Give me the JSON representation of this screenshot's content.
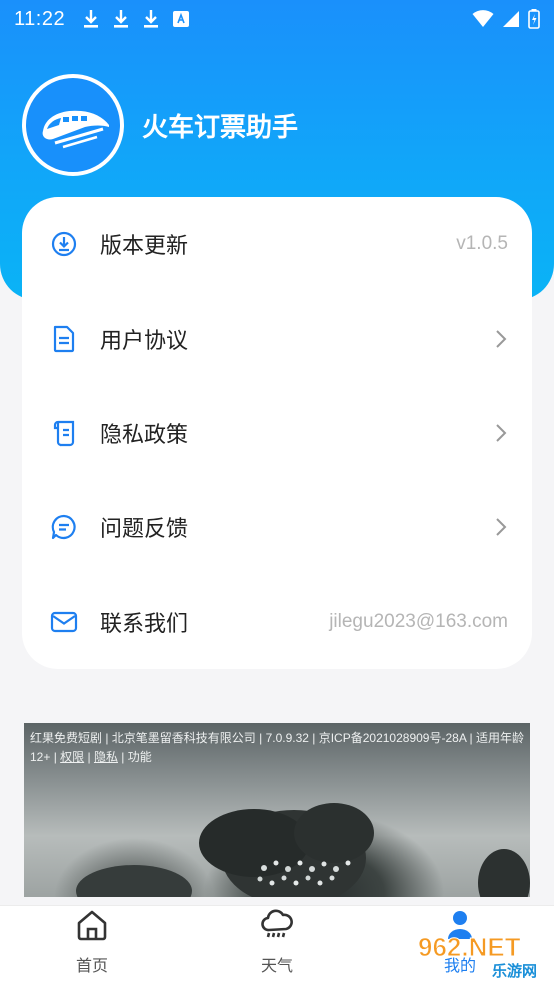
{
  "status_bar": {
    "time": "11:22",
    "left_icons": [
      "download-icon",
      "download-icon",
      "download-icon",
      "accessibility-icon"
    ],
    "right_icons": [
      "wifi-icon",
      "signal-icon",
      "battery-icon"
    ]
  },
  "app": {
    "name": "火车订票助手",
    "logo_icon": "train-icon"
  },
  "menu": {
    "items": [
      {
        "label": "版本更新",
        "value": "v1.0.5",
        "icon": "update-icon"
      },
      {
        "label": "用户协议",
        "value": "",
        "icon": "document-icon",
        "chevron": true
      },
      {
        "label": "隐私政策",
        "value": "",
        "icon": "policy-icon",
        "chevron": true
      },
      {
        "label": "问题反馈",
        "value": "",
        "icon": "feedback-icon",
        "chevron": true
      },
      {
        "label": "联系我们",
        "value": "jilegu2023@163.com",
        "icon": "mail-icon"
      }
    ]
  },
  "ad": {
    "text_main": "红果免费短剧 | 北京笔墨留香科技有限公司 | 7.0.9.32 | 京ICP备2021028909号-28A | 适用年龄12+ | ",
    "link_rights": "权限",
    "sep1": " | ",
    "link_privacy": "隐私",
    "sep2": " | ",
    "link_function": "功能"
  },
  "tab_bar": {
    "tabs": [
      {
        "label": "首页",
        "icon": "home-icon"
      },
      {
        "label": "天气",
        "icon": "weather-rain-icon"
      },
      {
        "label": "我的",
        "icon": "profile-icon"
      }
    ]
  },
  "watermark": {
    "brand": "962.NET",
    "sub": "乐游网"
  },
  "colors": {
    "header_gradient_start": "#1a90fb",
    "header_gradient_end": "#0ab3f6",
    "icon_blue": "#1e7ff0",
    "value_gray": "#b5b5b5"
  }
}
